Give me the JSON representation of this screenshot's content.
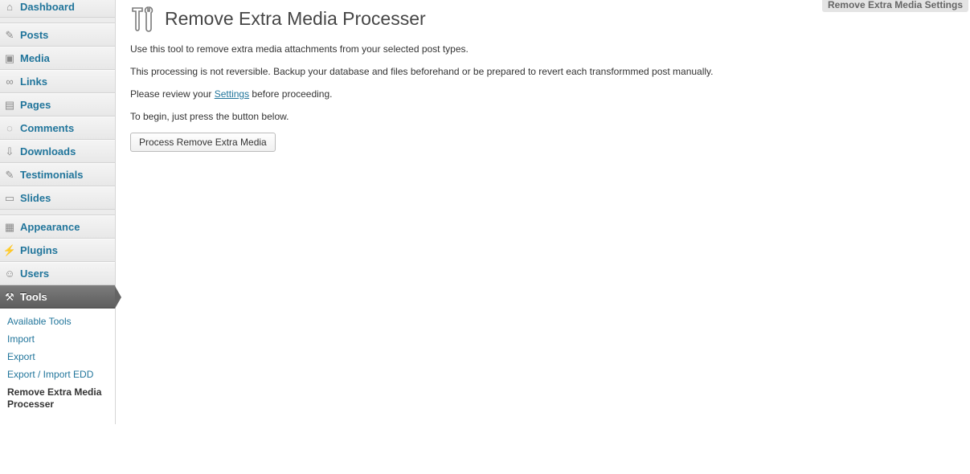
{
  "sidebar": {
    "items": [
      {
        "label": "Dashboard",
        "icon": "dashboard-icon",
        "glyph": "⌂"
      },
      {
        "label": "Posts",
        "icon": "pin-icon",
        "glyph": "✎"
      },
      {
        "label": "Media",
        "icon": "media-icon",
        "glyph": "▣"
      },
      {
        "label": "Links",
        "icon": "link-icon",
        "glyph": "∞"
      },
      {
        "label": "Pages",
        "icon": "pages-icon",
        "glyph": "▤"
      },
      {
        "label": "Comments",
        "icon": "comment-icon",
        "glyph": "◌"
      },
      {
        "label": "Downloads",
        "icon": "download-icon",
        "glyph": "⇩"
      },
      {
        "label": "Testimonials",
        "icon": "pin-icon",
        "glyph": "✎"
      },
      {
        "label": "Slides",
        "icon": "slides-icon",
        "glyph": "▭"
      },
      {
        "label": "Appearance",
        "icon": "appearance-icon",
        "glyph": "▦"
      },
      {
        "label": "Plugins",
        "icon": "plugin-icon",
        "glyph": "⚡"
      },
      {
        "label": "Users",
        "icon": "users-icon",
        "glyph": "☺"
      },
      {
        "label": "Tools",
        "icon": "tools-icon",
        "glyph": "⚒"
      }
    ],
    "submenu": [
      "Available Tools",
      "Import",
      "Export",
      "Export / Import EDD",
      "Remove Extra Media Processer"
    ]
  },
  "main": {
    "title": "Remove Extra Media Processer",
    "para1": "Use this tool to remove extra media attachments from your selected post types.",
    "para2": "This processing is not reversible. Backup your database and files beforehand or be prepared to revert each transformmed post manually.",
    "para3_before": "Please review your ",
    "para3_link": "Settings",
    "para3_after": " before proceeding.",
    "para4": "To begin, just press the button below.",
    "button": "Process Remove Extra Media"
  },
  "header": {
    "settings_tab": "Remove Extra Media Settings"
  },
  "colors": {
    "link": "#21759b",
    "active_menu": "#636363",
    "text": "#333333"
  }
}
